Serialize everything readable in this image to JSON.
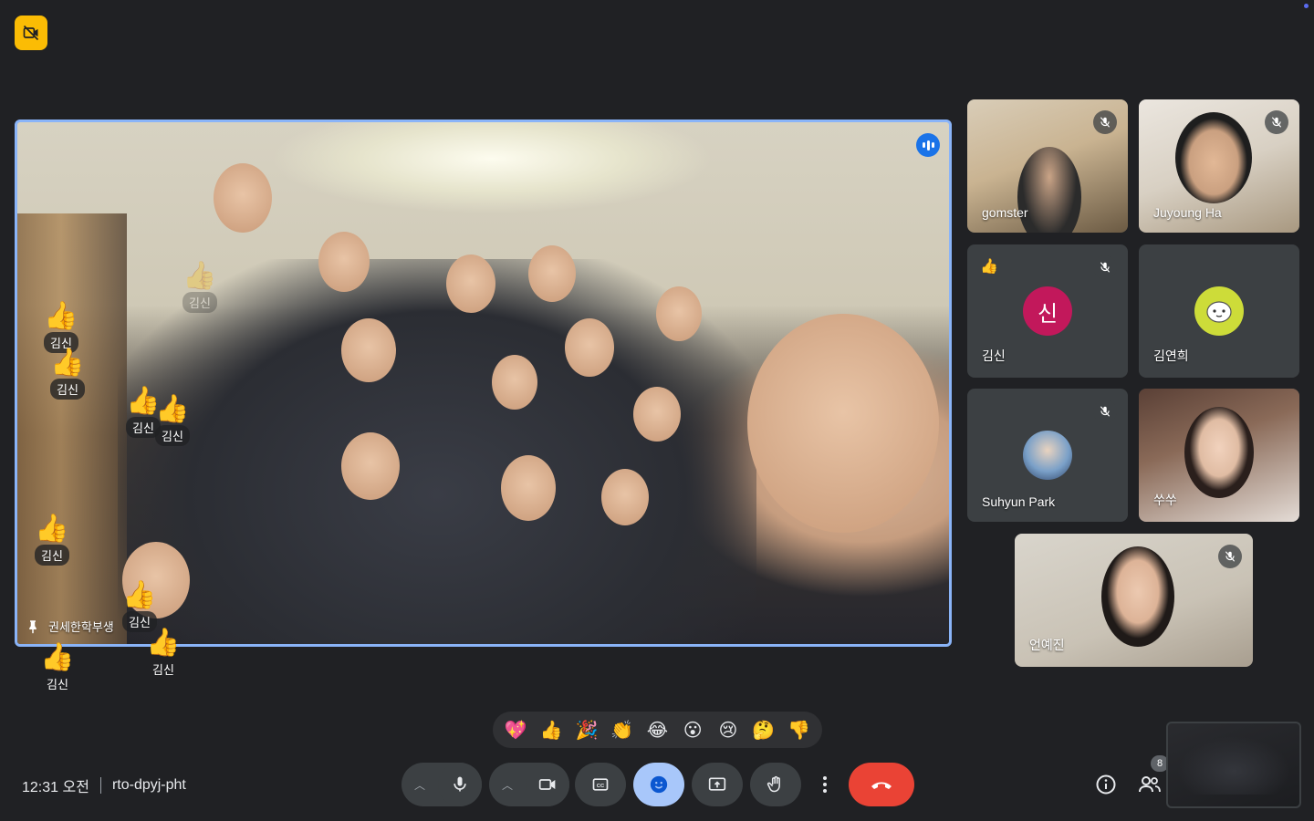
{
  "top": {
    "camera_status_icon": "no-video-recording-icon"
  },
  "main_tile": {
    "presenter": "권세한학부생",
    "pin_icon": "pin-icon",
    "speaking_icon": "speaking-indicator-icon",
    "highlight_color": "#8ab4f8"
  },
  "floating_reactions": [
    {
      "emoji": "👍",
      "name": "김신"
    },
    {
      "emoji": "👍",
      "name": "김신"
    },
    {
      "emoji": "👍",
      "name": "김신"
    },
    {
      "emoji": "👍",
      "name": "김신"
    },
    {
      "emoji": "👍",
      "name": "김신"
    },
    {
      "emoji": "👍",
      "name": "김신"
    },
    {
      "emoji": "👍",
      "name": "김신"
    },
    {
      "emoji": "👍",
      "name": "김신"
    },
    {
      "emoji": "👍",
      "name": "김신"
    }
  ],
  "participants": [
    {
      "name": "gomster",
      "muted": true,
      "type": "video"
    },
    {
      "name": "Juyoung Ha",
      "muted": true,
      "type": "video"
    },
    {
      "name": "김신",
      "muted": true,
      "type": "avatar",
      "initial": "신",
      "avatar_color": "#c2185b",
      "reaction": "👍"
    },
    {
      "name": "김연희",
      "muted": false,
      "type": "avatar",
      "avatar_color": "#cddc39"
    },
    {
      "name": "Suhyun Park",
      "muted": true,
      "type": "avatar"
    },
    {
      "name": "쑤쑤",
      "muted": false,
      "type": "video"
    },
    {
      "name": "언예진",
      "muted": true,
      "type": "video"
    }
  ],
  "reaction_bar": [
    "💖",
    "👍",
    "🎉",
    "👏",
    "😂",
    "😮",
    "😢",
    "🤔",
    "👎"
  ],
  "meeting": {
    "time": "12:31 오전",
    "code": "rto-dpyj-pht"
  },
  "controls": {
    "mic_icon": "microphone-icon",
    "camera_icon": "video-camera-icon",
    "captions_icon": "closed-captions-icon",
    "emoji_icon": "emoji-smile-icon",
    "present_icon": "present-screen-icon",
    "hand_icon": "raise-hand-icon",
    "more_icon": "more-options-icon",
    "end_icon": "end-call-icon"
  },
  "right_controls": {
    "info_icon": "info-icon",
    "people_icon": "people-icon",
    "people_count": "8",
    "chat_icon": "chat-icon",
    "activities_icon": "activities-icon",
    "host_icon": "host-controls-lock-icon"
  },
  "colors": {
    "end_call": "#ea4335",
    "active_control": "#a8c7fa",
    "background": "#202124"
  }
}
